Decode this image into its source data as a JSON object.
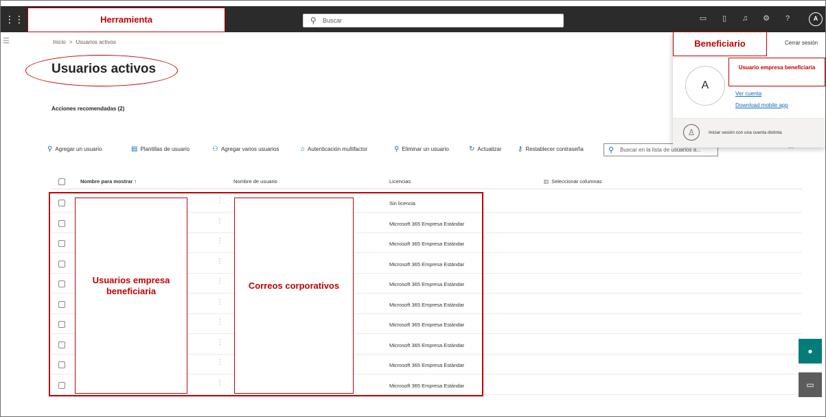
{
  "topbar": {
    "search_placeholder": "Buscar",
    "avatar_initial": "A"
  },
  "annotations": {
    "herramienta": "Herramienta",
    "beneficiario": "Beneficiario",
    "usuario_empresa_beneficiaria": "Usuario empresa beneficiaria",
    "usuarios_empresa_beneficiaria": "Usuarios empresa beneficiaria",
    "correos_corporativos": "Correos corporativos",
    "color": "#c00000"
  },
  "breadcrumb": {
    "home": "Inicio",
    "separator": ">",
    "current": "Usuarios activos"
  },
  "page": {
    "title": "Usuarios activos",
    "recommended_actions": "Acciones recomendadas (2)"
  },
  "commands": {
    "add_user": "Agregar un usuario",
    "user_templates": "Plantillas de usuario",
    "add_multiple": "Agregar varios usuarios",
    "mfa": "Autenticación multifactor",
    "delete_user": "Eliminar un usuario",
    "refresh": "Actualizar",
    "reset_password": "Restablecer contraseña",
    "list_search_placeholder": "Buscar en la lista de usuarios a...",
    "more": "..."
  },
  "table": {
    "headers": {
      "display_name": "Nombre para mostrar ↑",
      "username": "Nombre de usuario",
      "licenses": "Licencias",
      "choose_columns": "Seleccionar columnas"
    },
    "rows": [
      {
        "license": "Sin licencia"
      },
      {
        "license": "Microsoft 365 Empresa Estándar"
      },
      {
        "license": "Microsoft 365 Empresa Estándar"
      },
      {
        "license": "Microsoft 365 Empresa Estándar"
      },
      {
        "license": "Microsoft 365 Empresa Estándar"
      },
      {
        "license": "Microsoft 365 Empresa Estándar"
      },
      {
        "license": "Microsoft 365 Empresa Estándar"
      },
      {
        "license": "Microsoft 365 Empresa Estándar"
      },
      {
        "license": "Microsoft 365 Empresa Estándar"
      },
      {
        "license": "Microsoft 365 Empresa Estándar"
      }
    ]
  },
  "account_flyout": {
    "sign_out": "Cerrar sesión",
    "avatar_initial": "A",
    "view_account": "Ver cuenta",
    "download_app": "Download mobile app",
    "alt_signin": "Iniciar sesión con una cuenta distinta"
  },
  "colors": {
    "topbar": "#2b2b2b",
    "accent": "#0f6cbd",
    "fab_top": "#037c7a",
    "fab_bottom": "#5c5c5c"
  }
}
